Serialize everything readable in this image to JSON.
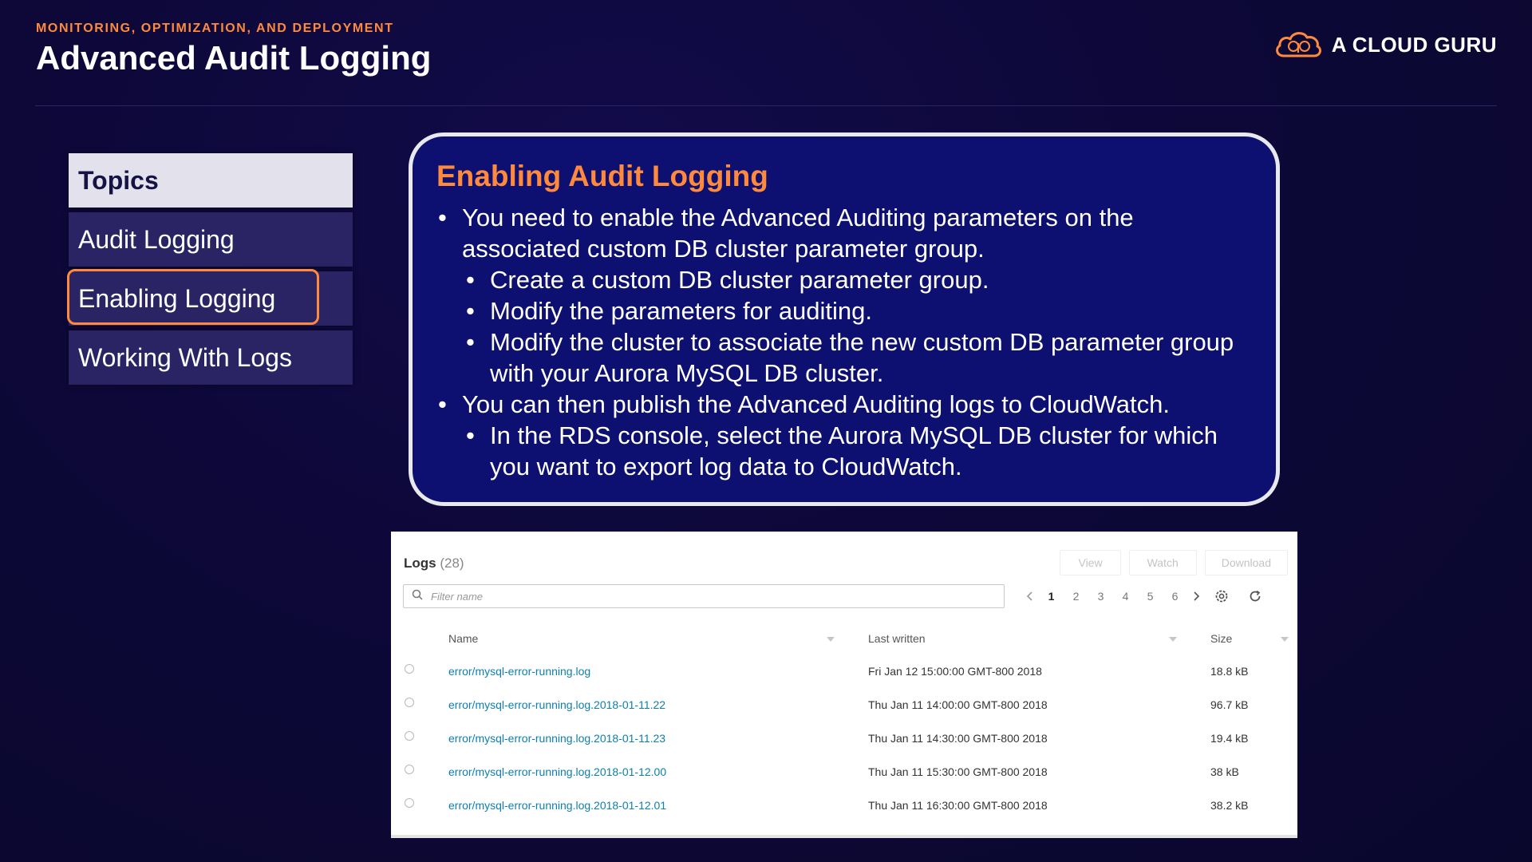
{
  "header": {
    "section": "MONITORING, OPTIMIZATION, AND DEPLOYMENT",
    "title": "Advanced Audit Logging"
  },
  "brand": {
    "name": "A CLOUD GURU",
    "icon": "cloud-logo-icon",
    "color": "#ff8a3d"
  },
  "sidebar": {
    "header": "Topics",
    "items": [
      {
        "label": "Audit Logging",
        "active": false
      },
      {
        "label": "Enabling Logging",
        "active": true
      },
      {
        "label": "Working With Logs",
        "active": false
      }
    ]
  },
  "content": {
    "heading": "Enabling Audit Logging",
    "bullets": [
      {
        "level": 1,
        "text": "You need to enable the Advanced Auditing parameters on the associated custom DB cluster parameter group."
      },
      {
        "level": 2,
        "text": "Create a custom DB cluster parameter group."
      },
      {
        "level": 2,
        "text": "Modify the parameters for auditing."
      },
      {
        "level": 2,
        "text": "Modify the cluster to associate the new custom DB parameter group with your Aurora MySQL DB cluster."
      },
      {
        "level": 1,
        "text": "You can then publish the Advanced Auditing logs to CloudWatch."
      },
      {
        "level": 2,
        "text": "In the RDS console, select the Aurora MySQL DB cluster for which you want to export log data to CloudWatch."
      }
    ]
  },
  "logs": {
    "title": "Logs",
    "count": "(28)",
    "actions": {
      "view": "View",
      "watch": "Watch",
      "download": "Download"
    },
    "filter_placeholder": "Filter name",
    "pagination": {
      "pages": [
        "1",
        "2",
        "3",
        "4",
        "5",
        "6"
      ],
      "current": "1"
    },
    "columns": {
      "name": "Name",
      "last_written": "Last written",
      "size": "Size"
    },
    "rows": [
      {
        "name": "error/mysql-error-running.log",
        "last_written": "Fri Jan 12 15:00:00 GMT-800 2018",
        "size": "18.8 kB"
      },
      {
        "name": "error/mysql-error-running.log.2018-01-11.22",
        "last_written": "Thu Jan 11 14:00:00 GMT-800 2018",
        "size": "96.7 kB"
      },
      {
        "name": "error/mysql-error-running.log.2018-01-11.23",
        "last_written": "Thu Jan 11 14:30:00 GMT-800 2018",
        "size": "19.4 kB"
      },
      {
        "name": "error/mysql-error-running.log.2018-01-12.00",
        "last_written": "Thu Jan 11 15:30:00 GMT-800 2018",
        "size": "38 kB"
      },
      {
        "name": "error/mysql-error-running.log.2018-01-12.01",
        "last_written": "Thu Jan 11 16:30:00 GMT-800 2018",
        "size": "38.2 kB"
      }
    ]
  },
  "colors": {
    "accent": "#ff8a3d",
    "background": "#0d0838",
    "card": "#0d1070",
    "link": "#0d7fb0"
  }
}
